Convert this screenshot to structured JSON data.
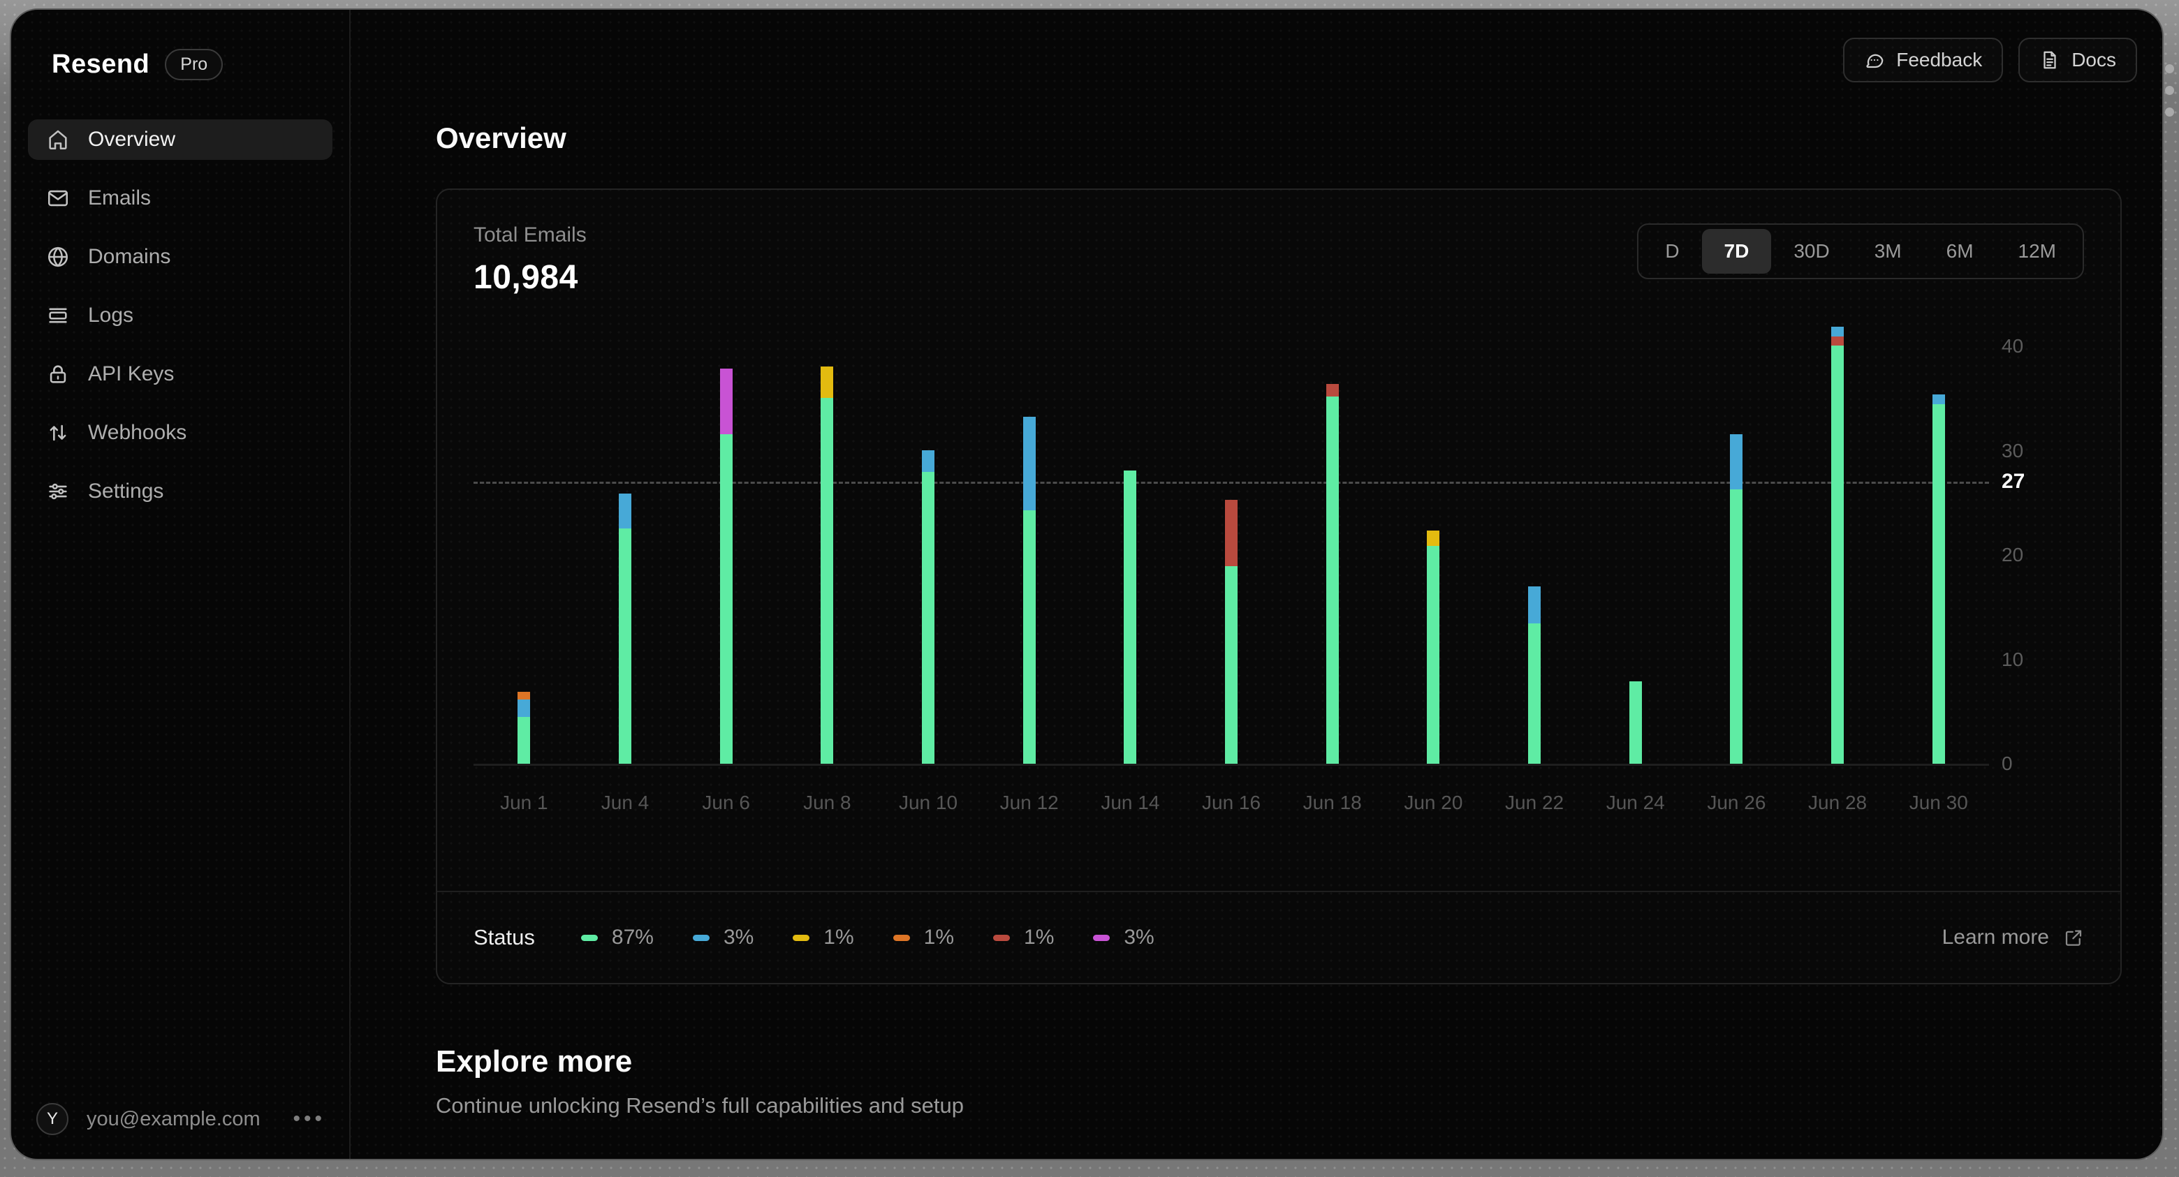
{
  "window": {
    "brand": "Resend",
    "plan_badge": "Pro"
  },
  "sidebar": {
    "items": [
      {
        "label": "Overview",
        "icon": "home",
        "active": true
      },
      {
        "label": "Emails",
        "icon": "mail",
        "active": false
      },
      {
        "label": "Domains",
        "icon": "globe",
        "active": false
      },
      {
        "label": "Logs",
        "icon": "rows",
        "active": false
      },
      {
        "label": "API Keys",
        "icon": "lock",
        "active": false
      },
      {
        "label": "Webhooks",
        "icon": "arrows-up-down",
        "active": false
      },
      {
        "label": "Settings",
        "icon": "sliders",
        "active": false
      }
    ],
    "user": {
      "avatar_initial": "Y",
      "email": "you@example.com"
    }
  },
  "topbar": {
    "feedback_label": "Feedback",
    "docs_label": "Docs"
  },
  "page": {
    "title": "Overview"
  },
  "card": {
    "metric_label": "Total Emails",
    "metric_value": "10,984",
    "ranges": [
      "D",
      "7D",
      "30D",
      "3M",
      "6M",
      "12M"
    ],
    "active_range": "7D",
    "status_label": "Status",
    "learn_more_label": "Learn more"
  },
  "explore": {
    "title": "Explore more",
    "subtitle": "Continue unlocking Resend’s full capabilities and setup"
  },
  "chart_data": {
    "type": "bar",
    "stacked": true,
    "title": "Total Emails",
    "total_label": "10,984",
    "x_labels": [
      "Jun 1",
      "Jun 4",
      "Jun 6",
      "Jun 8",
      "Jun 10",
      "Jun 12",
      "Jun 14",
      "Jun 16",
      "Jun 18",
      "Jun 20",
      "Jun 22",
      "Jun 24",
      "Jun 26",
      "Jun 28",
      "Jun 30"
    ],
    "y_ticks": [
      40,
      30,
      20,
      10,
      0
    ],
    "ylim": [
      0,
      40
    ],
    "average_line": 27,
    "grid": "dashed-average-only",
    "legend_position": "bottom",
    "colors": {
      "green": "#5feca4",
      "blue": "#47a9d7",
      "yellow": "#e3bb10",
      "orange": "#dd7526",
      "red": "#b94a3e",
      "purple": "#c853d4"
    },
    "legend": [
      {
        "key": "green",
        "value": "87%"
      },
      {
        "key": "blue",
        "value": "3%"
      },
      {
        "key": "yellow",
        "value": "1%"
      },
      {
        "key": "orange",
        "value": "1%"
      },
      {
        "key": "red",
        "value": "1%"
      },
      {
        "key": "purple",
        "value": "3%"
      }
    ],
    "series": [
      {
        "x": "Jun 1",
        "segments": [
          [
            "green",
            4.6
          ],
          [
            "blue",
            1.7
          ],
          [
            "orange",
            0.7
          ]
        ]
      },
      {
        "x": "Jun 4",
        "segments": [
          [
            "green",
            22.7
          ],
          [
            "blue",
            3.3
          ]
        ]
      },
      {
        "x": "Jun 6",
        "segments": [
          [
            "green",
            31.7
          ],
          [
            "purple",
            6.3
          ]
        ]
      },
      {
        "x": "Jun 8",
        "segments": [
          [
            "green",
            35.2
          ],
          [
            "yellow",
            3.0
          ]
        ]
      },
      {
        "x": "Jun 10",
        "segments": [
          [
            "green",
            28.1
          ],
          [
            "blue",
            2.1
          ]
        ]
      },
      {
        "x": "Jun 12",
        "segments": [
          [
            "green",
            24.4
          ],
          [
            "blue",
            9.0
          ]
        ]
      },
      {
        "x": "Jun 14",
        "segments": [
          [
            "green",
            28.2
          ]
        ]
      },
      {
        "x": "Jun 16",
        "segments": [
          [
            "green",
            19.1
          ],
          [
            "red",
            6.3
          ]
        ]
      },
      {
        "x": "Jun 18",
        "segments": [
          [
            "green",
            35.3
          ],
          [
            "red",
            1.2
          ]
        ]
      },
      {
        "x": "Jun 20",
        "segments": [
          [
            "green",
            21.0
          ],
          [
            "yellow",
            1.5
          ]
        ]
      },
      {
        "x": "Jun 22",
        "segments": [
          [
            "green",
            13.6
          ],
          [
            "blue",
            3.5
          ]
        ]
      },
      {
        "x": "Jun 24",
        "segments": [
          [
            "green",
            8.0
          ]
        ]
      },
      {
        "x": "Jun 26",
        "segments": [
          [
            "green",
            26.4
          ],
          [
            "blue",
            5.3
          ]
        ]
      },
      {
        "x": "Jun 28",
        "segments": [
          [
            "green",
            40.2
          ],
          [
            "red",
            0.9
          ],
          [
            "blue",
            0.9
          ]
        ]
      },
      {
        "x": "Jun 30",
        "segments": [
          [
            "green",
            34.6
          ],
          [
            "blue",
            0.9
          ]
        ]
      }
    ]
  }
}
